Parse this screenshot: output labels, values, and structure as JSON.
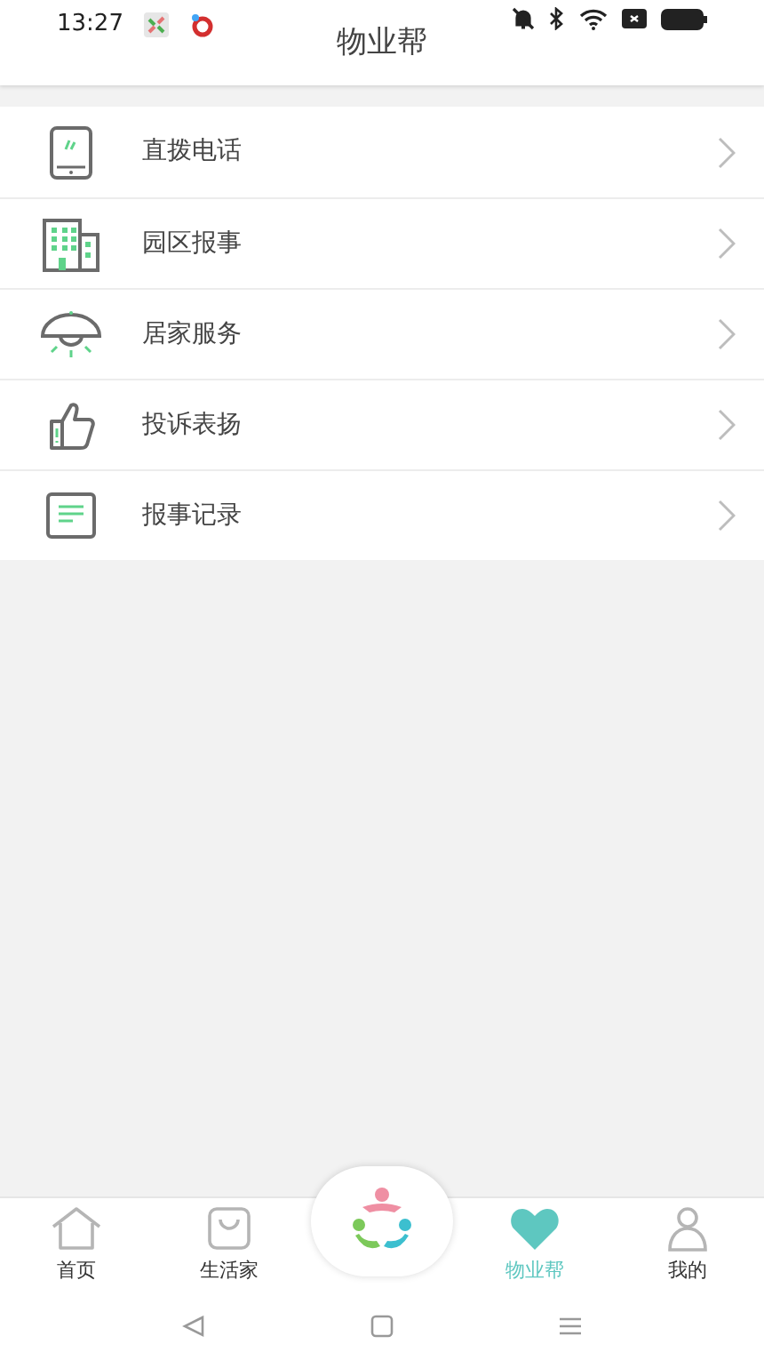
{
  "status_bar": {
    "time": "13:27"
  },
  "header": {
    "title": "物业帮"
  },
  "menu": [
    {
      "kind": "tablet",
      "label": "直拨电话"
    },
    {
      "kind": "building",
      "label": "园区报事"
    },
    {
      "kind": "lamp",
      "label": "居家服务"
    },
    {
      "kind": "thumb",
      "label": "投诉表扬"
    },
    {
      "kind": "note",
      "label": "报事记录"
    }
  ],
  "bottom_nav": [
    {
      "kind": "home",
      "label": "首页",
      "selected": false
    },
    {
      "kind": "bag",
      "label": "生活家",
      "selected": false
    },
    {
      "kind": "center"
    },
    {
      "kind": "heart",
      "label": "物业帮",
      "selected": true
    },
    {
      "kind": "person",
      "label": "我的",
      "selected": false
    }
  ]
}
